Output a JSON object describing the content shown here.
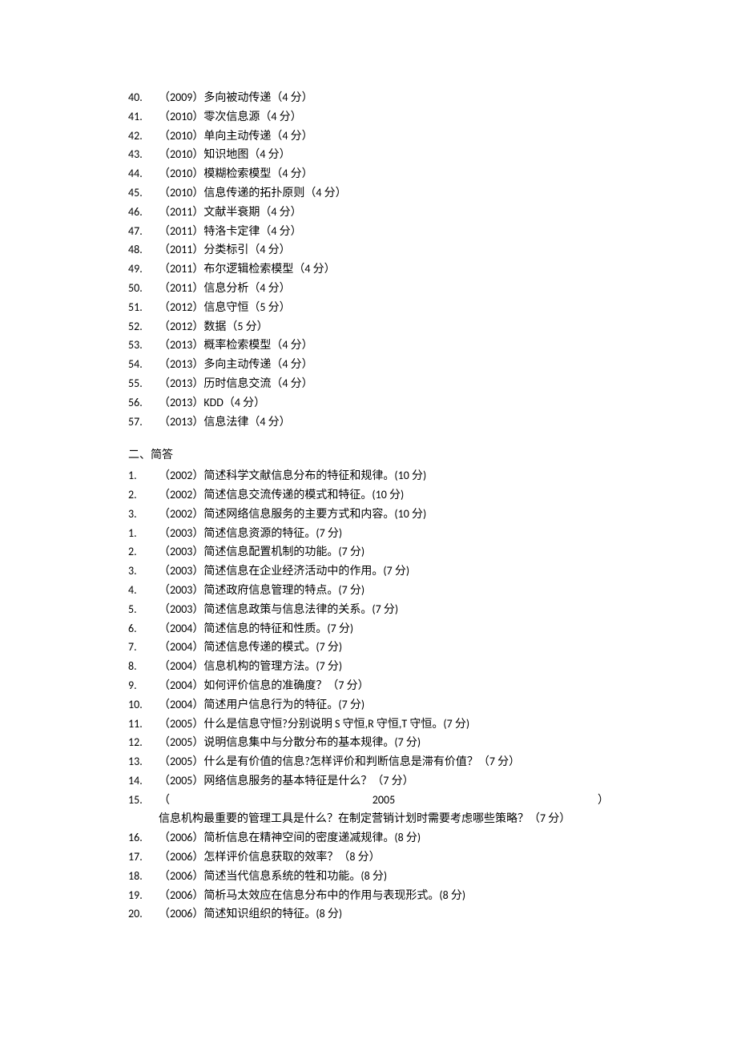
{
  "section1_items": [
    {
      "num": "40.",
      "text": "（2009）多向被动传递（4 分）"
    },
    {
      "num": "41.",
      "text": "（2010）零次信息源（4 分）"
    },
    {
      "num": "42.",
      "text": "（2010）单向主动传递（4 分）"
    },
    {
      "num": "43.",
      "text": "（2010）知识地图（4 分）"
    },
    {
      "num": "44.",
      "text": "（2010）模糊检索模型（4 分）"
    },
    {
      "num": "45.",
      "text": "（2010）信息传递的拓扑原则（4 分）"
    },
    {
      "num": "46.",
      "text": "（2011）文献半衰期（4 分）"
    },
    {
      "num": "47.",
      "text": "（2011）特洛卡定律（4 分）"
    },
    {
      "num": "48.",
      "text": "（2011）分类标引（4 分）"
    },
    {
      "num": "49.",
      "text": "（2011）布尔逻辑检索模型（4 分）"
    },
    {
      "num": "50.",
      "text": "（2011）信息分析（4 分）"
    },
    {
      "num": "51.",
      "text": "（2012）信息守恒（5 分）"
    },
    {
      "num": "52.",
      "text": "（2012）数据（5 分）"
    },
    {
      "num": "53.",
      "text": "（2013）概率检索模型（4 分）"
    },
    {
      "num": "54.",
      "text": "（2013）多向主动传递（4 分）"
    },
    {
      "num": "55.",
      "text": "（2013）历时信息交流（4 分）"
    },
    {
      "num": "56.",
      "text": "（2013）KDD（4 分）"
    },
    {
      "num": "57.",
      "text": "（2013）信息法律（4 分）"
    }
  ],
  "section2_title": "二、简答",
  "section2_items_a": [
    {
      "num": "1.",
      "text": "（2002）简述科学文献信息分布的特征和规律。(10 分)"
    },
    {
      "num": "2.",
      "text": "（2002）简述信息交流传递的模式和特征。(10 分)"
    },
    {
      "num": "3.",
      "text": "（2002）简述网络信息服务的主要方式和内容。(10 分)"
    },
    {
      "num": "1.",
      "text": "（2003）简述信息资源的特征。(7 分)"
    },
    {
      "num": "2.",
      "text": "（2003）简述信息配置机制的功能。(7 分)"
    },
    {
      "num": "3.",
      "text": "（2003）简述信息在企业经济活动中的作用。(7 分)"
    },
    {
      "num": "4.",
      "text": "（2003）简述政府信息管理的特点。(7 分)"
    },
    {
      "num": "5.",
      "text": "（2003）简述信息政策与信息法律的关系。(7 分)"
    },
    {
      "num": "6.",
      "text": "（2004）简述信息的特征和性质。(7 分)"
    },
    {
      "num": "7.",
      "text": "（2004）简述信息传递的模式。(7 分)"
    },
    {
      "num": "8.",
      "text": "（2004）信息机构的管理方法。(7 分)"
    },
    {
      "num": "9.",
      "text": "（2004）如何评价信息的准确度？（7 分）"
    },
    {
      "num": "10.",
      "text": "（2004）简述用户信息行为的特征。(7 分)"
    },
    {
      "num": "11.",
      "text": "（2005）什么是信息守恒?分别说明 S 守恒,R 守恒,T 守恒。(7 分)"
    },
    {
      "num": "12.",
      "text": "（2005）说明信息集中与分散分布的基本规律。(7 分)"
    },
    {
      "num": "13.",
      "text": "（2005）什么是有价值的信息?怎样评价和判断信息是滞有价值？（7 分）"
    },
    {
      "num": "14.",
      "text": "（2005）网络信息服务的基本特征是什么？（7 分）"
    }
  ],
  "item15": {
    "num": "15.",
    "open": "（",
    "year": "2005",
    "close": "）",
    "line2": "信息机构最重要的管理工具是什么？在制定营销计划时需要考虑哪些策略？（7 分）"
  },
  "section2_items_b": [
    {
      "num": "16.",
      "text": "（2006）简析信息在精神空间的密度递减规律。(8 分)"
    },
    {
      "num": "17.",
      "text": "（2006）怎样评价信息获取的效率？（8 分）"
    },
    {
      "num": "18.",
      "text": "（2006）简述当代信息系统的牲和功能。(8 分)"
    },
    {
      "num": "19.",
      "text": "（2006）简析马太效应在信息分布中的作用与表现形式。(8 分)"
    },
    {
      "num": "20.",
      "text": "（2006）简述知识组织的特征。(8 分)"
    }
  ]
}
